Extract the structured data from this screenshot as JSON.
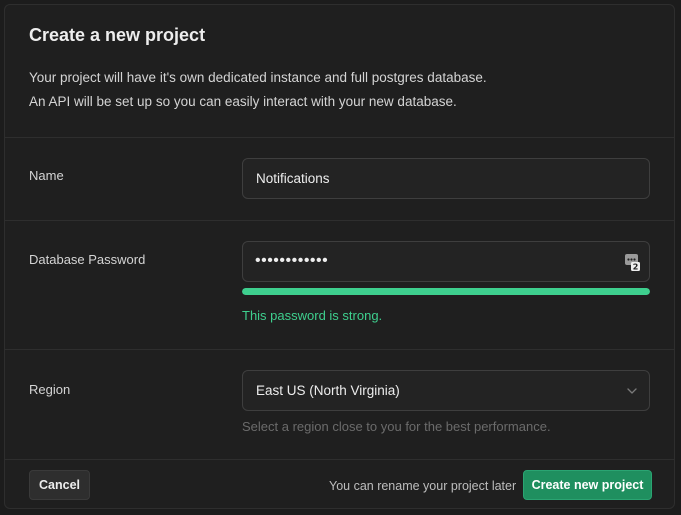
{
  "dialog": {
    "title": "Create a new project",
    "description": [
      "Your project will have it's own dedicated instance and full postgres database.",
      "An API will be set up so you can easily interact with your new database."
    ]
  },
  "name_field": {
    "label": "Name",
    "value": "Notifications"
  },
  "password_field": {
    "label": "Database Password",
    "value": "••••••••••••",
    "icon": "password-manager-icon",
    "strength_fraction": 1.0,
    "strength_text": "This password is strong.",
    "strength_color": "#3ecf8e"
  },
  "region_field": {
    "label": "Region",
    "value": "East US (North Virginia)",
    "hint": "Select a region close to you for the best performance.",
    "icon": "chevron-down-icon"
  },
  "footer": {
    "cancel_label": "Cancel",
    "note": "You can rename your project later",
    "create_label": "Create new project"
  },
  "colors": {
    "background": "#1f1f1f",
    "accent": "#3ecf8e",
    "primary_button": "#1f8f5f"
  }
}
